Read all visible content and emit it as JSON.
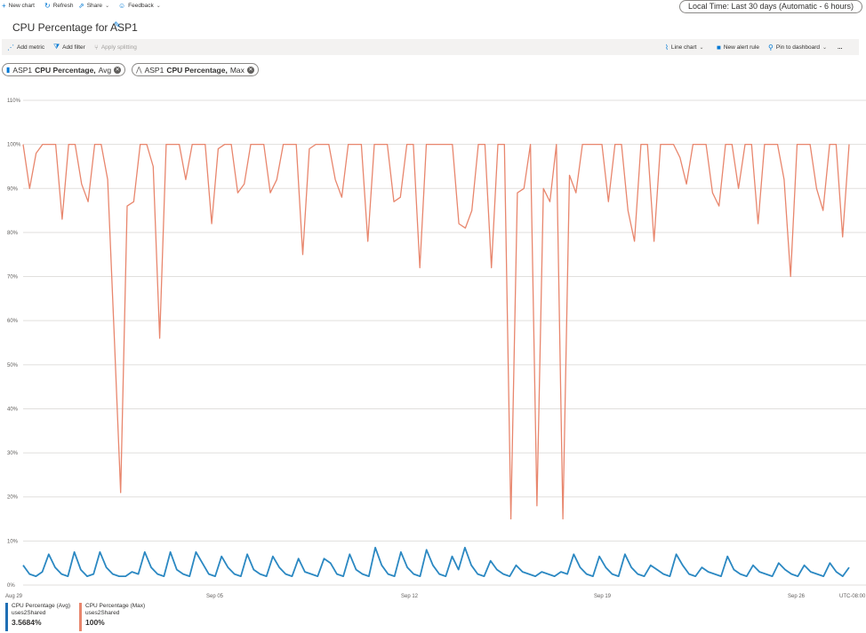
{
  "topbar": {
    "new_chart": "New chart",
    "refresh": "Refresh",
    "share": "Share",
    "feedback": "Feedback",
    "time_range": "Local Time: Last 30 days (Automatic - 6 hours)"
  },
  "title": "CPU Percentage for ASP1",
  "toolbar": {
    "add_metric": "Add metric",
    "add_filter": "Add filter",
    "apply_splitting": "Apply splitting",
    "line_chart": "Line chart",
    "new_alert_rule": "New alert rule",
    "pin_to_dashboard": "Pin to dashboard",
    "more": "..."
  },
  "metric_pills": [
    {
      "resource": "ASP1",
      "metric": "CPU Percentage,",
      "agg": "Avg"
    },
    {
      "resource": "ASP1",
      "metric": "CPU Percentage,",
      "agg": "Max"
    }
  ],
  "chart_data": {
    "type": "line",
    "y_ticks": [
      "110%",
      "100%",
      "90%",
      "80%",
      "70%",
      "60%",
      "50%",
      "40%",
      "30%",
      "20%",
      "10%",
      "0%"
    ],
    "ylim": [
      0,
      110
    ],
    "x_ticks": [
      "Aug 29",
      "Sep 05",
      "Sep 12",
      "Sep 19",
      "Sep 26",
      "UTC-08:00"
    ],
    "grid": true,
    "series": [
      {
        "name": "CPU Percentage (Max)",
        "color": "#e8866d",
        "values": [
          100,
          90,
          98,
          100,
          100,
          100,
          83,
          100,
          100,
          91,
          87,
          100,
          100,
          92,
          57,
          21,
          86,
          87,
          100,
          100,
          95,
          56,
          100,
          100,
          100,
          92,
          100,
          100,
          100,
          82,
          99,
          100,
          100,
          89,
          91,
          100,
          100,
          100,
          89,
          92,
          100,
          100,
          100,
          75,
          99,
          100,
          100,
          100,
          92,
          88,
          100,
          100,
          100,
          78,
          100,
          100,
          100,
          87,
          88,
          100,
          100,
          72,
          100,
          100,
          100,
          100,
          100,
          82,
          81,
          85,
          100,
          100,
          72,
          100,
          100,
          15,
          89,
          90,
          100,
          18,
          90,
          87,
          100,
          15,
          93,
          89,
          100,
          100,
          100,
          100,
          87,
          100,
          100,
          85,
          78,
          100,
          100,
          78,
          100,
          100,
          100,
          97,
          91,
          100,
          100,
          100,
          89,
          86,
          100,
          100,
          90,
          100,
          100,
          82,
          100,
          100,
          100,
          92,
          70,
          100,
          100,
          100,
          90,
          85,
          100,
          100,
          79,
          100
        ]
      },
      {
        "name": "CPU Percentage (Avg)",
        "color": "#2b88c2",
        "values": [
          4.5,
          2.5,
          2.0,
          3.0,
          7.0,
          4.0,
          2.5,
          2.0,
          7.5,
          3.5,
          2.0,
          2.5,
          7.5,
          4.0,
          2.5,
          2.0,
          2.0,
          3.0,
          2.5,
          7.5,
          4.0,
          2.5,
          2.0,
          7.5,
          3.5,
          2.5,
          2.0,
          7.5,
          5.0,
          2.5,
          2.0,
          6.5,
          4.0,
          2.5,
          2.0,
          7.0,
          3.5,
          2.5,
          2.0,
          6.5,
          4.0,
          2.5,
          2.0,
          6.0,
          3.0,
          2.5,
          2.0,
          6.0,
          5.0,
          2.5,
          2.0,
          7.0,
          3.5,
          2.5,
          2.0,
          8.5,
          4.5,
          2.5,
          2.0,
          7.5,
          4.0,
          2.5,
          2.0,
          8.0,
          4.5,
          2.5,
          2.0,
          6.5,
          3.5,
          8.5,
          4.5,
          2.5,
          2.0,
          5.5,
          3.5,
          2.5,
          2.0,
          4.5,
          3.0,
          2.5,
          2.0,
          3.0,
          2.5,
          2.0,
          3.0,
          2.5,
          7.0,
          4.0,
          2.5,
          2.0,
          6.5,
          4.0,
          2.5,
          2.0,
          7.0,
          4.0,
          2.5,
          2.0,
          4.5,
          3.5,
          2.5,
          2.0,
          7.0,
          4.5,
          2.5,
          2.0,
          4.0,
          3.0,
          2.5,
          2.0,
          6.5,
          3.5,
          2.5,
          2.0,
          4.5,
          3.0,
          2.5,
          2.0,
          5.0,
          3.5,
          2.5,
          2.0,
          4.5,
          3.0,
          2.5,
          2.0,
          5.0,
          3.0,
          2.0,
          4.0
        ]
      }
    ]
  },
  "legend": [
    {
      "label": "CPU Percentage (Avg)",
      "sub": "uses2Shared",
      "value": "3.5684%",
      "color": "#1f6fb4"
    },
    {
      "label": "CPU Percentage (Max)",
      "sub": "uses2Shared",
      "value": "100%",
      "color": "#e8866d"
    }
  ]
}
